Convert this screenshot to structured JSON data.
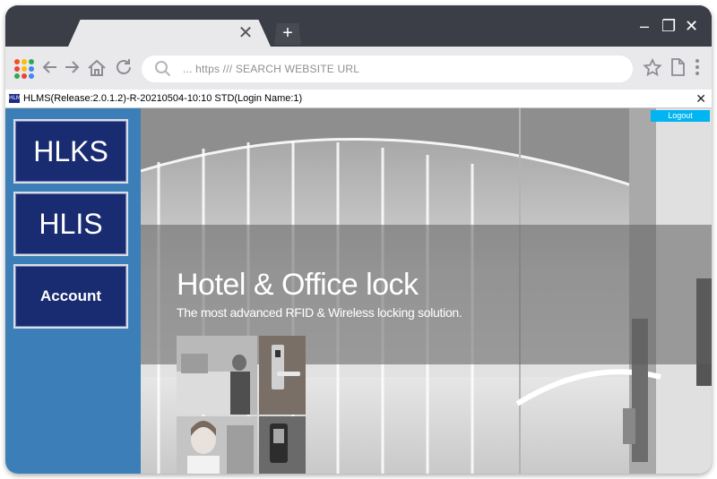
{
  "browser": {
    "new_tab_label": "+",
    "tab_close": "✕",
    "url_placeholder": "... https /// SEARCH WEBSITE URL",
    "window_controls": {
      "minimize": "–",
      "restore": "❐",
      "close": "✕"
    },
    "apps_colors": [
      "#f4511e",
      "#fbbc05",
      "#34a853",
      "#ea4335",
      "#fbbc05",
      "#4285f4",
      "#34a853",
      "#ea4335",
      "#4285f4"
    ],
    "icons": [
      "apps-grid-icon",
      "back-arrow-icon",
      "forward-arrow-icon",
      "home-icon",
      "reload-icon",
      "search-icon",
      "bookmark-star-icon",
      "page-icon",
      "more-vert-icon"
    ]
  },
  "app": {
    "title": "HLMS(Release:2.0.1.2)-R-20210504-10:10 STD(Login Name:1)",
    "close_label": "✕",
    "nav": [
      {
        "label": "HLKS"
      },
      {
        "label": "HLIS"
      },
      {
        "label": "Account"
      }
    ],
    "logout_label": "Logout",
    "hero_title": "Hotel & Office lock",
    "hero_subtitle": "The most advanced RFID & Wireless locking solution.",
    "colors": {
      "sidebar": "#3c7fb8",
      "nav_button": "#1a2c71",
      "logout": "#00b5f1"
    }
  }
}
